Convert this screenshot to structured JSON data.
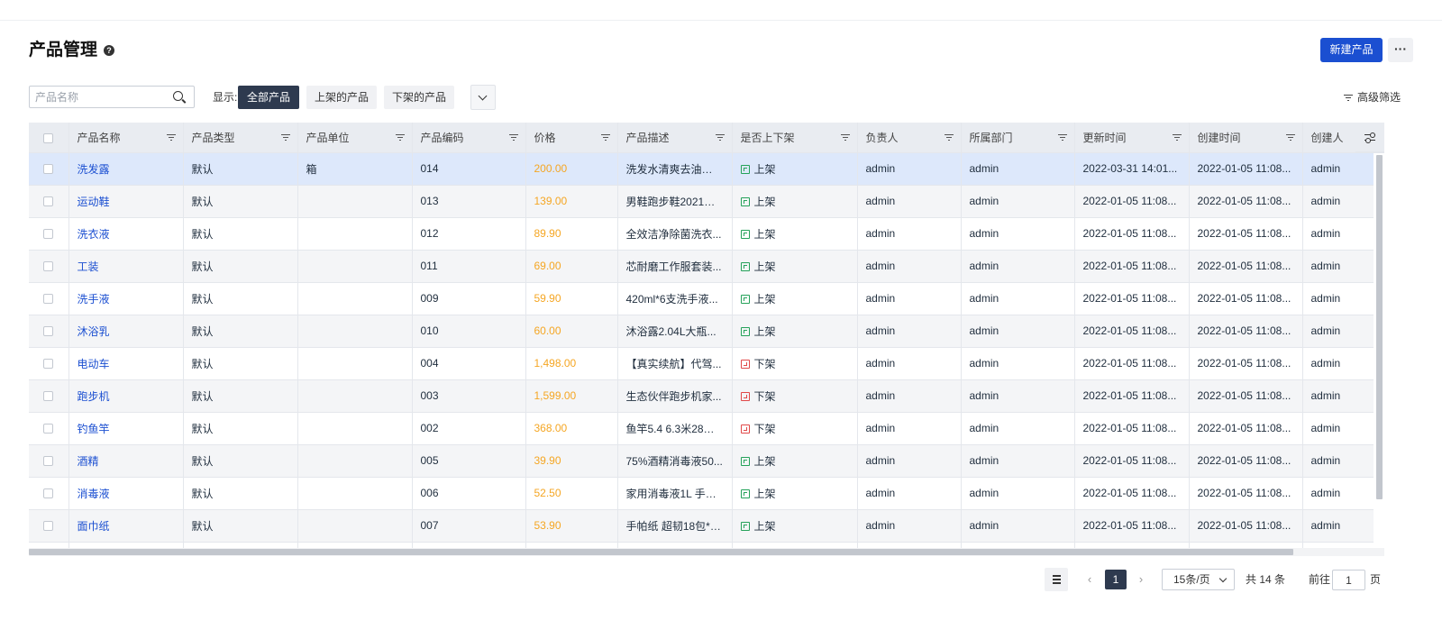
{
  "header": {
    "title": "产品管理",
    "help_icon": "question-circle-icon",
    "new_button": "新建产品",
    "more_button": "···"
  },
  "toolbar": {
    "search_placeholder": "产品名称",
    "show_label": "显示:",
    "tabs": [
      "全部产品",
      "上架的产品",
      "下架的产品"
    ],
    "active_tab": 0,
    "advanced_filter": "高级筛选"
  },
  "table": {
    "columns": [
      "产品名称",
      "产品类型",
      "产品单位",
      "产品编码",
      "价格",
      "产品描述",
      "是否上下架",
      "负责人",
      "所属部门",
      "更新时间",
      "创建时间",
      "创建人"
    ],
    "colors": {
      "link": "#1b4fd1",
      "price": "#f5a623",
      "on": "#25a25a",
      "off": "#e04848",
      "selected_row": "#dde8fb"
    },
    "rows": [
      {
        "name": "洗发露",
        "type": "默认",
        "unit": "箱",
        "code": "014",
        "price": "200.00",
        "desc": "洗发水清爽去油型1...",
        "status": "上架",
        "owner": "admin",
        "dept": "admin",
        "updated": "2022-03-31 14:01...",
        "created": "2022-01-05 11:08...",
        "creator": "admin"
      },
      {
        "name": "运动鞋",
        "type": "默认",
        "unit": "",
        "code": "013",
        "price": "139.00",
        "desc": "男鞋跑步鞋2021新...",
        "status": "上架",
        "owner": "admin",
        "dept": "admin",
        "updated": "2022-01-05 11:08...",
        "created": "2022-01-05 11:08...",
        "creator": "admin"
      },
      {
        "name": "洗衣液",
        "type": "默认",
        "unit": "",
        "code": "012",
        "price": "89.90",
        "desc": "全效洁净除菌洗衣...",
        "status": "上架",
        "owner": "admin",
        "dept": "admin",
        "updated": "2022-01-05 11:08...",
        "created": "2022-01-05 11:08...",
        "creator": "admin"
      },
      {
        "name": "工装",
        "type": "默认",
        "unit": "",
        "code": "011",
        "price": "69.00",
        "desc": "芯耐磨工作服套装...",
        "status": "上架",
        "owner": "admin",
        "dept": "admin",
        "updated": "2022-01-05 11:08...",
        "created": "2022-01-05 11:08...",
        "creator": "admin"
      },
      {
        "name": "洗手液",
        "type": "默认",
        "unit": "",
        "code": "009",
        "price": "59.90",
        "desc": "420ml*6支洗手液...",
        "status": "上架",
        "owner": "admin",
        "dept": "admin",
        "updated": "2022-01-05 11:08...",
        "created": "2022-01-05 11:08...",
        "creator": "admin"
      },
      {
        "name": "沐浴乳",
        "type": "默认",
        "unit": "",
        "code": "010",
        "price": "60.00",
        "desc": "沐浴露2.04L大瓶...",
        "status": "上架",
        "owner": "admin",
        "dept": "admin",
        "updated": "2022-01-05 11:08...",
        "created": "2022-01-05 11:08...",
        "creator": "admin"
      },
      {
        "name": "电动车",
        "type": "默认",
        "unit": "",
        "code": "004",
        "price": "1,498.00",
        "desc": "【真实续航】代驾...",
        "status": "下架",
        "owner": "admin",
        "dept": "admin",
        "updated": "2022-01-05 11:08...",
        "created": "2022-01-05 11:08...",
        "creator": "admin"
      },
      {
        "name": "跑步机",
        "type": "默认",
        "unit": "",
        "code": "003",
        "price": "1,599.00",
        "desc": "生态伙伴跑步机家...",
        "status": "下架",
        "owner": "admin",
        "dept": "admin",
        "updated": "2022-01-05 11:08...",
        "created": "2022-01-05 11:08...",
        "creator": "admin"
      },
      {
        "name": "钓鱼竿",
        "type": "默认",
        "unit": "",
        "code": "002",
        "price": "368.00",
        "desc": "鱼竿5.4 6.3米28调...",
        "status": "下架",
        "owner": "admin",
        "dept": "admin",
        "updated": "2022-01-05 11:08...",
        "created": "2022-01-05 11:08...",
        "creator": "admin"
      },
      {
        "name": "酒精",
        "type": "默认",
        "unit": "",
        "code": "005",
        "price": "39.90",
        "desc": "75%酒精消毒液50...",
        "status": "上架",
        "owner": "admin",
        "dept": "admin",
        "updated": "2022-01-05 11:08...",
        "created": "2022-01-05 11:08...",
        "creator": "admin"
      },
      {
        "name": "消毒液",
        "type": "默认",
        "unit": "",
        "code": "006",
        "price": "52.50",
        "desc": "家用消毒液1L 手部...",
        "status": "上架",
        "owner": "admin",
        "dept": "admin",
        "updated": "2022-01-05 11:08...",
        "created": "2022-01-05 11:08...",
        "creator": "admin"
      },
      {
        "name": "面巾纸",
        "type": "默认",
        "unit": "",
        "code": "007",
        "price": "53.90",
        "desc": "手帕纸 超韧18包*4...",
        "status": "上架",
        "owner": "admin",
        "dept": "admin",
        "updated": "2022-01-05 11:08...",
        "created": "2022-01-05 11:08...",
        "creator": "admin"
      },
      {
        "name": "",
        "type": "",
        "unit": "",
        "code": "",
        "price": "",
        "desc": "",
        "status": "",
        "owner": "",
        "dept": "",
        "updated": "",
        "created": "",
        "creator": ""
      }
    ],
    "selected_row": 0
  },
  "pagination": {
    "current_page": "1",
    "page_size": "15条/页",
    "total": "共 14 条",
    "goto_label": "前往",
    "goto_value": "1",
    "page_label": "页"
  }
}
